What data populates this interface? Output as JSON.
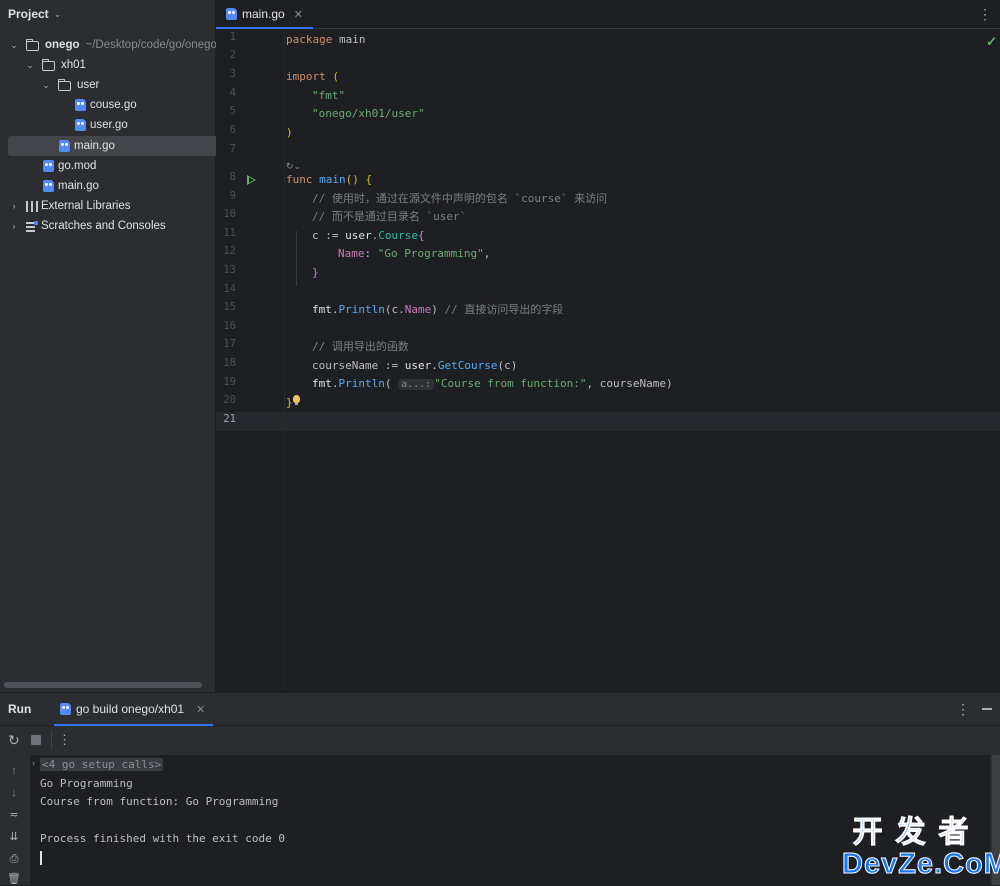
{
  "project": {
    "title": "Project",
    "tree": [
      {
        "label": "onego",
        "hint": "~/Desktop/code/go/onego",
        "kind": "folder",
        "expanded": true,
        "depth": 0,
        "bold": true
      },
      {
        "label": "xh01",
        "kind": "folder",
        "expanded": true,
        "depth": 1
      },
      {
        "label": "user",
        "kind": "folder",
        "expanded": true,
        "depth": 2
      },
      {
        "label": "couse.go",
        "kind": "gofile",
        "depth": 3
      },
      {
        "label": "user.go",
        "kind": "gofile",
        "depth": 3
      },
      {
        "label": "main.go",
        "kind": "gofile",
        "depth": 2,
        "selected": true
      },
      {
        "label": "go.mod",
        "kind": "gomod",
        "depth": 1
      },
      {
        "label": "main.go",
        "kind": "gofile",
        "depth": 1
      },
      {
        "label": "External Libraries",
        "kind": "library",
        "expanded": false,
        "depth": 0
      },
      {
        "label": "Scratches and Consoles",
        "kind": "scratch",
        "expanded": false,
        "depth": 0
      }
    ]
  },
  "editor": {
    "tab": "main.go",
    "current_line": 21,
    "line_count": 21,
    "code": {
      "l1_kw": "package",
      "l1_id": " main",
      "l3_kw": "import",
      "l3_paren": " (",
      "l4": "\"fmt\"",
      "l5": "\"onego/xh01/user\"",
      "l6": ")",
      "l8_kw": "func",
      "l8_fn": " main",
      "l8_rest": "() ",
      "l8_brace": "{",
      "l9": "// 使用时，通过在源文件中声明的包名 `course` 来访问",
      "l10": "// 而不是通过目录名 `user`",
      "l11_id": "c := ",
      "l11_pkg": "user",
      "l11_dot": ".",
      "l11_type": "Course",
      "l11_brace": "{",
      "l12_field": "Name",
      "l12_colon": ": ",
      "l12_str": "\"Go Programming\"",
      "l12_comma": ",",
      "l13": "}",
      "l15_pkg": "fmt",
      "l15_dot": ".",
      "l15_fn": "Println",
      "l15_arg": "(c.",
      "l15_field": "Name",
      "l15_close": ") ",
      "l15_cmt": "// 直接访问导出的字段",
      "l17": "// 调用导出的函数",
      "l18_id": "courseName := ",
      "l18_pkg": "user",
      "l18_dot": ".",
      "l18_fn": "GetCourse",
      "l18_arg": "(c)",
      "l19_pkg": "fmt",
      "l19_dot": ".",
      "l19_fn": "Println",
      "l19_open": "( ",
      "l19_hint": "a...:",
      "l19_str": "\"Course from function:\"",
      "l19_rest": ", courseName)",
      "l20": "}"
    }
  },
  "run": {
    "title": "Run",
    "tab": "go build onego/xh01",
    "console": {
      "fold": "<4 go setup calls>",
      "line1": "Go Programming",
      "line2": "Course from function: Go Programming",
      "line3": "Process finished with the exit code 0"
    }
  },
  "watermark": {
    "cn": "开发者",
    "en": "DevZe.CoM"
  },
  "colors": {
    "accent": "#3574f0",
    "run_green": "#5fb865",
    "keyword": "#cf8e6d",
    "string": "#6aab73",
    "function": "#56a8f5"
  }
}
